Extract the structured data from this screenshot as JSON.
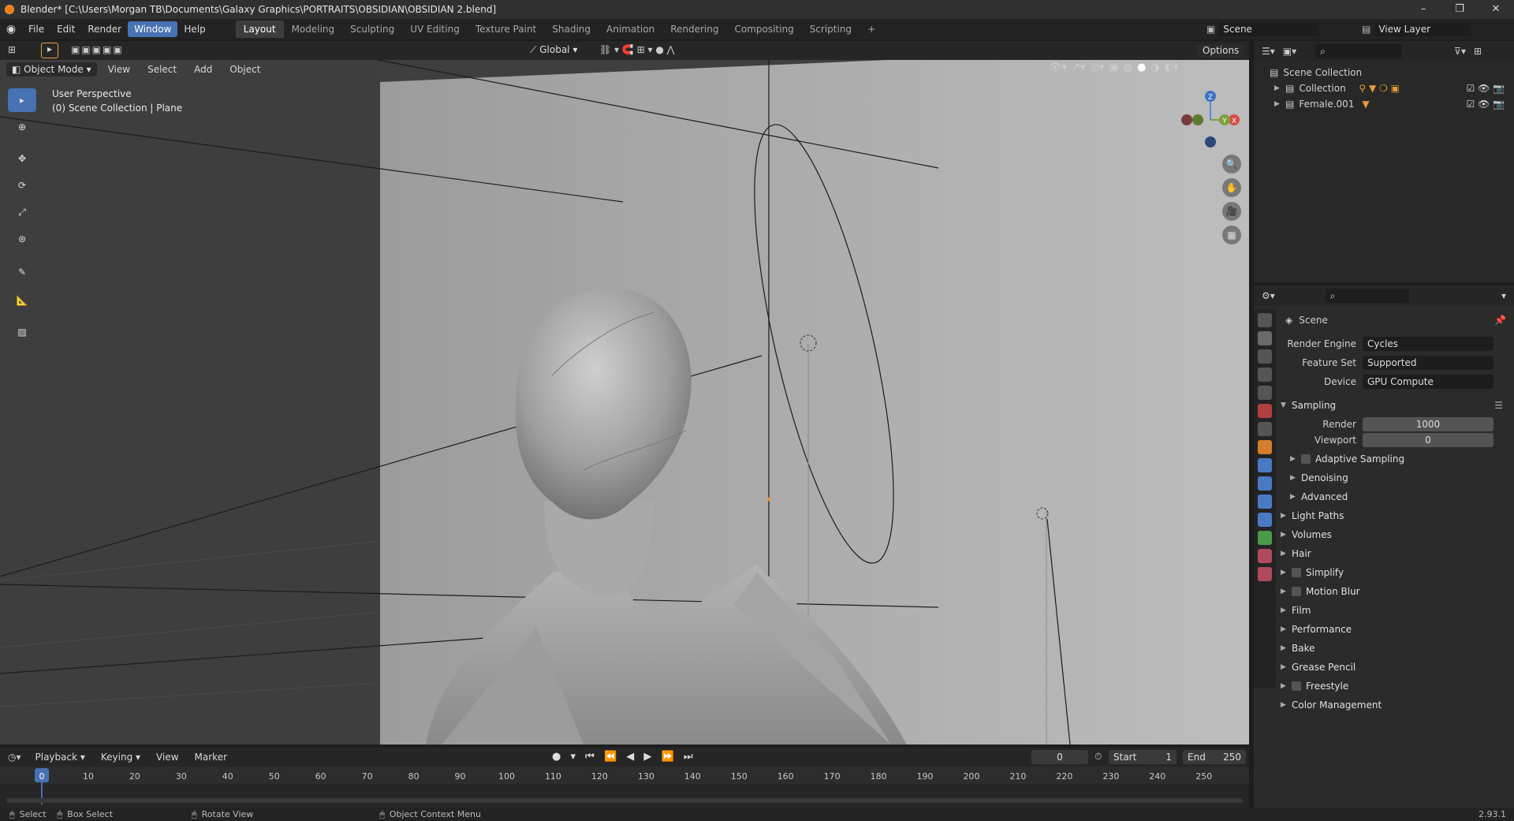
{
  "window": {
    "title": "Blender* [C:\\Users\\Morgan TB\\Documents\\Galaxy Graphics\\PORTRAITS\\OBSIDIAN\\OBSIDIAN 2.blend]",
    "minimize": "–",
    "restore": "❐",
    "close": "✕"
  },
  "menu": [
    "File",
    "Edit",
    "Render",
    "Window",
    "Help"
  ],
  "workspaces": [
    "Layout",
    "Modeling",
    "Sculpting",
    "UV Editing",
    "Texture Paint",
    "Shading",
    "Animation",
    "Rendering",
    "Compositing",
    "Scripting",
    "+"
  ],
  "scene_field": "Scene",
  "view_layer_field": "View Layer",
  "viewport": {
    "transform_orientation": "Global",
    "options": "Options",
    "mode": "Object Mode",
    "menus": [
      "View",
      "Select",
      "Add",
      "Object"
    ],
    "overlay_line1": "User Perspective",
    "overlay_line2": "(0) Scene Collection | Plane",
    "gizmo": {
      "z": "Z",
      "x": "X",
      "y": "Y"
    }
  },
  "outliner": {
    "search_placeholder": "",
    "rows": [
      {
        "label": "Scene Collection"
      },
      {
        "label": "Collection"
      },
      {
        "label": "Female.001"
      }
    ]
  },
  "properties": {
    "header": "Scene",
    "render_engine_label": "Render Engine",
    "render_engine_value": "Cycles",
    "feature_set_label": "Feature Set",
    "feature_set_value": "Supported",
    "device_label": "Device",
    "device_value": "GPU Compute",
    "sampling": "Sampling",
    "render_label": "Render",
    "render_value": "1000",
    "viewport_label": "Viewport",
    "viewport_value": "0",
    "sub_panels": [
      "Adaptive Sampling",
      "Denoising",
      "Advanced"
    ],
    "panels": [
      {
        "label": "Light Paths",
        "checkbox": false
      },
      {
        "label": "Volumes",
        "checkbox": false
      },
      {
        "label": "Hair",
        "checkbox": false
      },
      {
        "label": "Simplify",
        "checkbox": true
      },
      {
        "label": "Motion Blur",
        "checkbox": true
      },
      {
        "label": "Film",
        "checkbox": false
      },
      {
        "label": "Performance",
        "checkbox": false
      },
      {
        "label": "Bake",
        "checkbox": false
      },
      {
        "label": "Grease Pencil",
        "checkbox": false
      },
      {
        "label": "Freestyle",
        "checkbox": true
      },
      {
        "label": "Color Management",
        "checkbox": false
      }
    ]
  },
  "timeline": {
    "menus": [
      "Playback",
      "Keying",
      "View",
      "Marker"
    ],
    "current_frame": "0",
    "start_label": "Start",
    "start_value": "1",
    "end_label": "End",
    "end_value": "250",
    "ticks": [
      "0",
      "10",
      "20",
      "30",
      "40",
      "50",
      "60",
      "70",
      "80",
      "90",
      "100",
      "110",
      "120",
      "130",
      "140",
      "150",
      "160",
      "170",
      "180",
      "190",
      "200",
      "210",
      "220",
      "230",
      "240",
      "250"
    ]
  },
  "statusbar": {
    "select": "Select",
    "box_select": "Box Select",
    "rotate_view": "Rotate View",
    "context_menu": "Object Context Menu",
    "version": "2.93.1"
  }
}
